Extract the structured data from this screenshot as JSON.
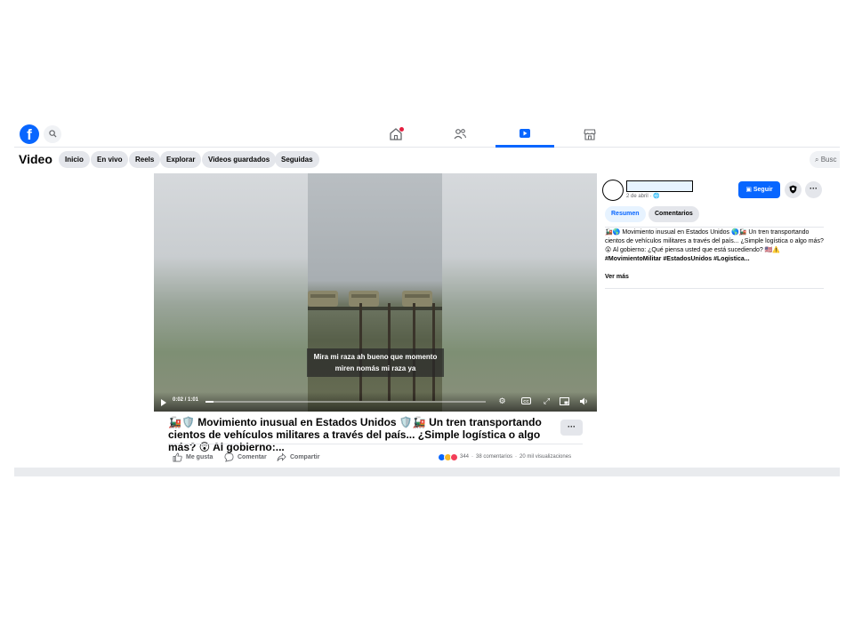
{
  "colors": {
    "brand": "#0866ff",
    "notification": "#e41e3f",
    "text": "#050505",
    "secondary": "#65676b"
  },
  "topnav": {
    "logo": "f",
    "tabs": [
      {
        "name": "home-icon",
        "active": false,
        "has_notification": true
      },
      {
        "name": "friends-icon",
        "active": false
      },
      {
        "name": "video-icon",
        "active": true
      },
      {
        "name": "marketplace-icon",
        "active": false
      }
    ]
  },
  "videobar": {
    "title": "Video",
    "pills": [
      "Inicio",
      "En vivo",
      "Reels",
      "Explorar",
      "Videos guardados",
      "Seguidas"
    ],
    "search_placeholder": "Busc"
  },
  "player": {
    "subtitle": "Mira mi raza ah bueno que momento miren nomás mi raza ya",
    "timecode": "0:02 / 1:01",
    "progress": 0.03,
    "controls": [
      "settings-icon",
      "captions-icon",
      "fullscreen-icon",
      "miniplayer-icon",
      "volume-icon"
    ]
  },
  "post": {
    "caption": "🚂🛡️ Movimiento inusual en Estados Unidos 🛡️🚂 Un tren transportando cientos de vehículos militares a través del país... ¿Simple logística o algo más? 😲 Al gobierno:...",
    "more_label": "···",
    "actions": {
      "like": "Me gusta",
      "comment": "Comentar",
      "share": "Compartir"
    },
    "stats": {
      "reactions": "344",
      "comments": "38 comentarios",
      "views": "20 mil visualizaciones",
      "separator": "·"
    }
  },
  "sidebar": {
    "date": "2 de abril · 🌐",
    "follow_label": "Seguir",
    "tabs": [
      "Resumen",
      "Comentarios"
    ],
    "description_part1": "🚂🌎 Movimiento inusual en Estados Unidos 🌎🚂 Un tren transportando cientos de vehículos militares a través del país... ¿Simple logística o algo más? 😲 Al gobierno: ¿Qué piensa usted que está sucediendo? 🇺🇸⚠️ ",
    "description_tags": "#MovimientoMilitar #EstadosUnidos #Logistica...",
    "see_more": "Ver más"
  }
}
